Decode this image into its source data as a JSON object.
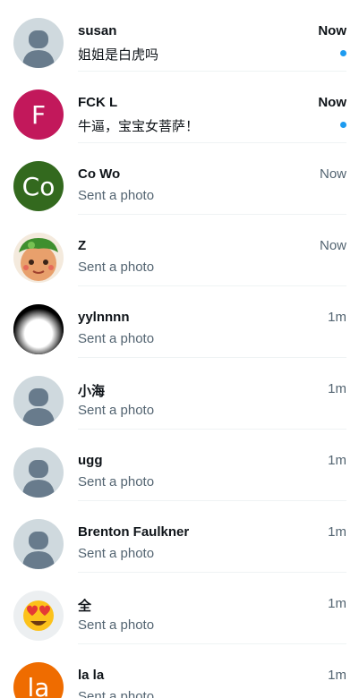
{
  "colors": {
    "accent": "#1d9bf0",
    "text_primary": "#0f1419",
    "text_secondary": "#536471",
    "divider": "#eff3f4",
    "default_avatar_bg": "#cfd9de",
    "default_avatar_fg": "#687b8c"
  },
  "conversations": [
    {
      "name": "susan",
      "preview": "姐姐是白虎吗",
      "time": "Now",
      "unread": true,
      "avatar": {
        "kind": "default-profile-icon"
      }
    },
    {
      "name": "FCK L",
      "preview": "牛逼，宝宝女菩萨！",
      "time": "Now",
      "unread": true,
      "avatar": {
        "kind": "letter",
        "text": "F",
        "color": "#c2185b"
      }
    },
    {
      "name": "Co Wo",
      "preview": "Sent a photo",
      "time": "Now",
      "unread": false,
      "avatar": {
        "kind": "letter",
        "text": "Co",
        "color": "#33691e"
      }
    },
    {
      "name": "Z",
      "preview": "Sent a photo",
      "time": "Now",
      "unread": false,
      "avatar": {
        "kind": "cartoon-character-image"
      }
    },
    {
      "name": "yylnnnn",
      "preview": "Sent a photo",
      "time": "1m",
      "unread": false,
      "avatar": {
        "kind": "black-white-glow-image"
      }
    },
    {
      "name": "小海",
      "preview": "Sent a photo",
      "time": "1m",
      "unread": false,
      "avatar": {
        "kind": "default-profile-icon"
      }
    },
    {
      "name": "ugg",
      "preview": "Sent a photo",
      "time": "1m",
      "unread": false,
      "avatar": {
        "kind": "default-profile-icon"
      }
    },
    {
      "name": "Brenton Faulkner",
      "preview": "Sent a photo",
      "time": "1m",
      "unread": false,
      "avatar": {
        "kind": "default-profile-icon"
      }
    },
    {
      "name": "全",
      "preview": "Sent a photo",
      "time": "1m",
      "unread": false,
      "avatar": {
        "kind": "heart-eyes-emoji-icon"
      }
    },
    {
      "name": "la la",
      "preview": "Sent a photo",
      "time": "1m",
      "unread": false,
      "avatar": {
        "kind": "letter",
        "text": "la",
        "color": "#ef6c00"
      }
    }
  ]
}
